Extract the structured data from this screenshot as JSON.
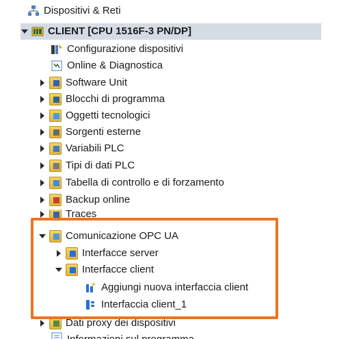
{
  "tree": {
    "items": [
      {
        "label": "Dispositivi & Reti",
        "icon": "network-icon"
      },
      {
        "label": "CLIENT [CPU 1516F-3 PN/DP]",
        "icon": "plc-device-icon"
      },
      {
        "label": "Configurazione dispositivi",
        "icon": "device-config-icon"
      },
      {
        "label": "Online & Diagnostica",
        "icon": "online-diagnostics-icon"
      },
      {
        "label": "Software Unit",
        "icon": "folder-software-unit-icon"
      },
      {
        "label": "Blocchi di programma",
        "icon": "folder-program-blocks-icon"
      },
      {
        "label": "Oggetti tecnologici",
        "icon": "folder-technology-objects-icon"
      },
      {
        "label": "Sorgenti esterne",
        "icon": "folder-external-sources-icon"
      },
      {
        "label": "Variabili PLC",
        "icon": "folder-plc-tags-icon"
      },
      {
        "label": "Tipi di dati PLC",
        "icon": "folder-plc-datatypes-icon"
      },
      {
        "label": "Tabella di controllo e di forzamento",
        "icon": "folder-watch-force-tables-icon"
      },
      {
        "label": "Backup online",
        "icon": "folder-online-backup-icon"
      },
      {
        "label": "Traces",
        "icon": "folder-traces-icon"
      },
      {
        "label": "Comunicazione OPC UA",
        "icon": "folder-opc-ua-icon"
      },
      {
        "label": "Interfacce server",
        "icon": "folder-server-interfaces-icon"
      },
      {
        "label": "Interfacce client",
        "icon": "folder-client-interfaces-icon"
      },
      {
        "label": "Aggiungi nuova interfaccia client",
        "icon": "add-client-interface-icon"
      },
      {
        "label": "Interfaccia client_1",
        "icon": "client-interface-icon"
      },
      {
        "label": "Dati proxy dei dispositivi",
        "icon": "folder-device-proxy-icon"
      },
      {
        "label": "Informazioni sul programma",
        "icon": "program-info-icon"
      }
    ]
  },
  "colors": {
    "highlight": "#f0731e",
    "selection": "#d4dbe3"
  }
}
